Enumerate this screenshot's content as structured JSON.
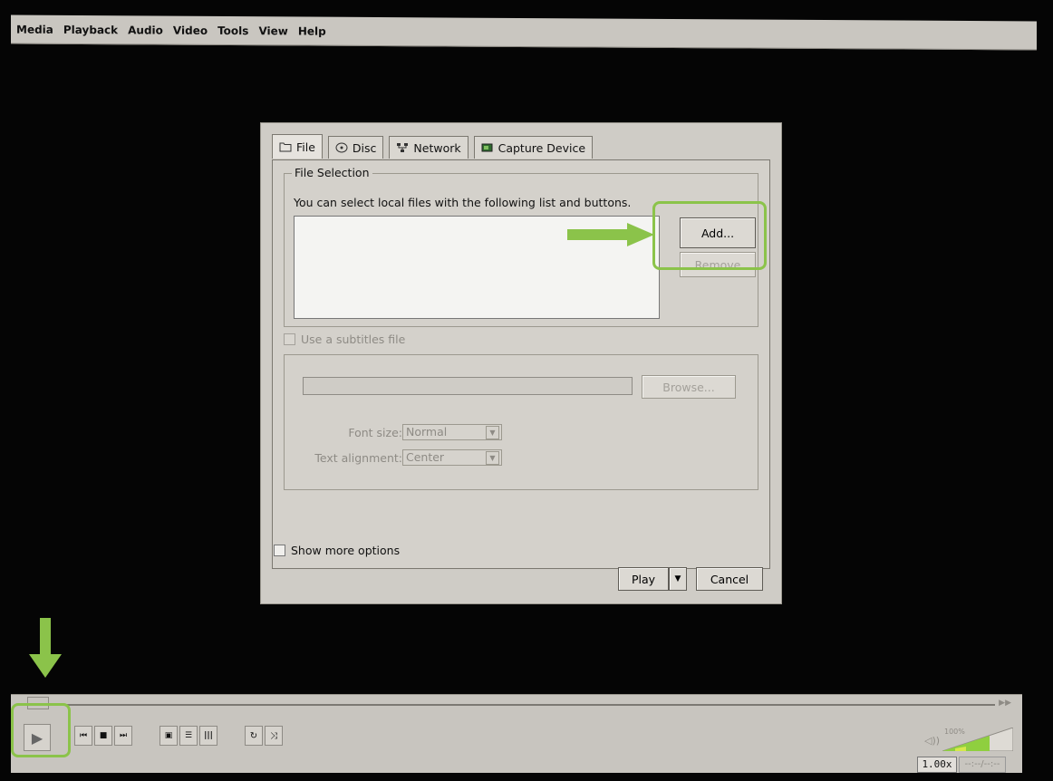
{
  "menu": {
    "items": [
      "Media",
      "Playback",
      "Audio",
      "Video",
      "Tools",
      "View",
      "Help"
    ]
  },
  "dialog": {
    "tabs": [
      {
        "label": "File",
        "icon": "folder-icon"
      },
      {
        "label": "Disc",
        "icon": "disc-icon"
      },
      {
        "label": "Network",
        "icon": "network-icon"
      },
      {
        "label": "Capture Device",
        "icon": "capture-device-icon"
      }
    ],
    "file_selection": {
      "legend": "File Selection",
      "hint": "You can select local files with the following list and buttons.",
      "add_label": "Add...",
      "remove_label": "Remove"
    },
    "subtitles": {
      "checkbox_label": "Use a subtitles file",
      "browse_label": "Browse...",
      "font_size_label": "Font size:",
      "font_size_value": "Normal",
      "text_alignment_label": "Text alignment:",
      "text_alignment_value": "Center"
    },
    "more_options_label": "Show more options",
    "play_label": "Play",
    "cancel_label": "Cancel"
  },
  "player": {
    "speed": "1.00x",
    "time": "--:--/--:--",
    "volume_percent": "100%",
    "controls": [
      "previous-icon",
      "stop-icon",
      "next-icon",
      "fullscreen-icon",
      "playlist-icon",
      "extended-settings-icon",
      "loop-icon",
      "shuffle-icon"
    ]
  },
  "colors": {
    "highlight": "#8bc34a",
    "background": "#050505",
    "dialog_bg": "#cfccc6"
  }
}
